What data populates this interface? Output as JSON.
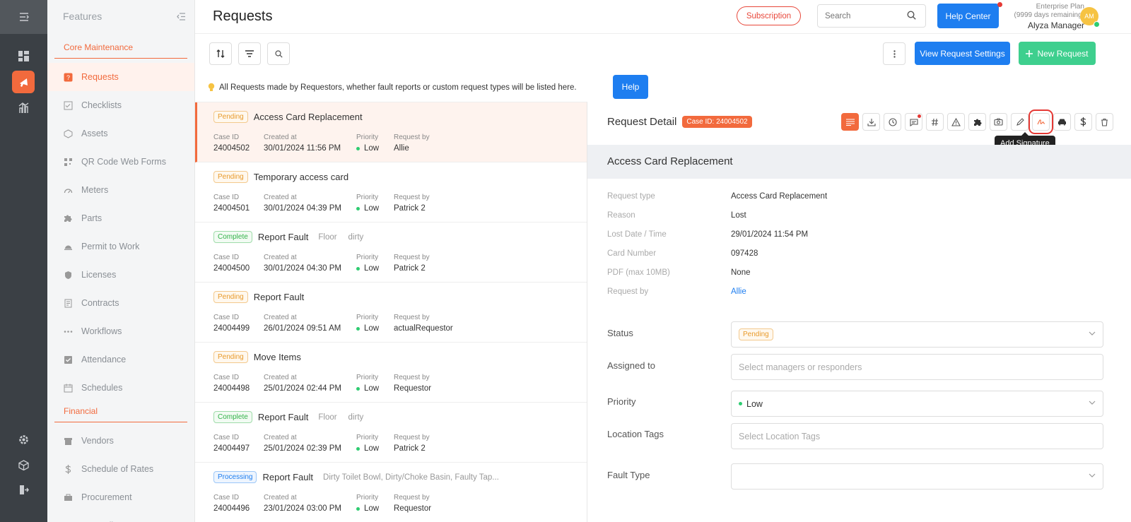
{
  "rail": {
    "icons": [
      "collapse-menu-icon",
      "dashboard-icon",
      "megaphone-icon",
      "analytics-icon",
      "settings-icon",
      "box-icon",
      "logout-icon"
    ]
  },
  "sidebar": {
    "header": "Features",
    "section_core": "Core Maintenance",
    "items_core": [
      {
        "label": "Requests",
        "icon": "request-icon"
      },
      {
        "label": "Checklists",
        "icon": "checklist-icon"
      },
      {
        "label": "Assets",
        "icon": "assets-icon"
      },
      {
        "label": "QR Code Web Forms",
        "icon": "qr-code-icon"
      },
      {
        "label": "Meters",
        "icon": "meter-icon"
      },
      {
        "label": "Parts",
        "icon": "puzzle-icon"
      },
      {
        "label": "Permit to Work",
        "icon": "hardhat-icon"
      },
      {
        "label": "Licenses",
        "icon": "shield-icon"
      },
      {
        "label": "Contracts",
        "icon": "contract-icon"
      },
      {
        "label": "Workflows",
        "icon": "workflow-icon"
      },
      {
        "label": "Attendance",
        "icon": "attendance-icon"
      },
      {
        "label": "Schedules",
        "icon": "calendar-icon"
      }
    ],
    "section_financial": "Financial",
    "items_financial": [
      {
        "label": "Vendors",
        "icon": "vendor-icon"
      },
      {
        "label": "Schedule of Rates",
        "icon": "dollar-icon"
      },
      {
        "label": "Procurement",
        "icon": "procurement-icon"
      },
      {
        "label": "Expenditures",
        "icon": "expenditure-icon"
      }
    ]
  },
  "topbar": {
    "title": "Requests",
    "subscription": "Subscription",
    "search_placeholder": "Search",
    "help_center": "Help Center",
    "plan": "Enterprise Plan",
    "days": "(9999 days remaining)",
    "user": "Alyza Manager",
    "avatar": "AM"
  },
  "toolbar": {
    "view_settings": "View Request Settings",
    "new_request": "New Request"
  },
  "info": {
    "text": "All Requests made by Requestors, whether fault reports or custom request types will be listed here.",
    "help": "Help"
  },
  "list_labels": {
    "case": "Case ID",
    "created": "Created at",
    "priority": "Priority",
    "by": "Request by"
  },
  "requests": [
    {
      "status": "Pending",
      "status_class": "pending",
      "title": "Access Card Replacement",
      "tags": "",
      "case_id": "24004502",
      "created": "30/01/2024 11:56 PM",
      "priority": "Low",
      "by": "Allie"
    },
    {
      "status": "Pending",
      "status_class": "pending",
      "title": "Temporary access card",
      "tags": "",
      "case_id": "24004501",
      "created": "30/01/2024 04:39 PM",
      "priority": "Low",
      "by": "Patrick 2"
    },
    {
      "status": "Complete",
      "status_class": "complete",
      "title": "Report Fault",
      "tags": "Floor     dirty",
      "case_id": "24004500",
      "created": "30/01/2024 04:30 PM",
      "priority": "Low",
      "by": "Patrick 2"
    },
    {
      "status": "Pending",
      "status_class": "pending",
      "title": "Report Fault",
      "tags": "",
      "case_id": "24004499",
      "created": "26/01/2024 09:51 AM",
      "priority": "Low",
      "by": "actualRequestor"
    },
    {
      "status": "Pending",
      "status_class": "pending",
      "title": "Move Items",
      "tags": "",
      "case_id": "24004498",
      "created": "25/01/2024 02:44 PM",
      "priority": "Low",
      "by": "Requestor"
    },
    {
      "status": "Complete",
      "status_class": "complete",
      "title": "Report Fault",
      "tags": "Floor     dirty",
      "case_id": "24004497",
      "created": "25/01/2024 02:39 PM",
      "priority": "Low",
      "by": "Patrick 2"
    },
    {
      "status": "Processing",
      "status_class": "processing",
      "title": "Report Fault",
      "tags": "Dirty Toilet Bowl, Dirty/Choke Basin, Faulty Tap...",
      "case_id": "24004496",
      "created": "23/01/2024 03:00 PM",
      "priority": "Low",
      "by": "Requestor"
    }
  ],
  "detail": {
    "heading": "Request Detail",
    "case_badge": "Case ID: 24004502",
    "tooltip": "Add Signature",
    "title": "Access Card Replacement",
    "fields": [
      {
        "label": "Request type",
        "value": "Access Card Replacement"
      },
      {
        "label": "Reason",
        "value": "Lost"
      },
      {
        "label": "Lost Date / Time",
        "value": "29/01/2024 11:54 PM"
      },
      {
        "label": "Card Number",
        "value": "097428"
      },
      {
        "label": "PDF (max 10MB)",
        "value": "None"
      },
      {
        "label": "Request by",
        "value": "Allie"
      }
    ],
    "status_label": "Status",
    "status_value": "Pending",
    "assigned_label": "Assigned to",
    "assigned_placeholder": "Select managers or responders",
    "priority_label": "Priority",
    "priority_value": "Low",
    "location_label": "Location Tags",
    "location_placeholder": "Select Location Tags",
    "fault_label": "Fault Type"
  },
  "colors": {
    "accent": "#f26a3d",
    "primary": "#1e7ef0",
    "success": "#3ecf8e"
  }
}
